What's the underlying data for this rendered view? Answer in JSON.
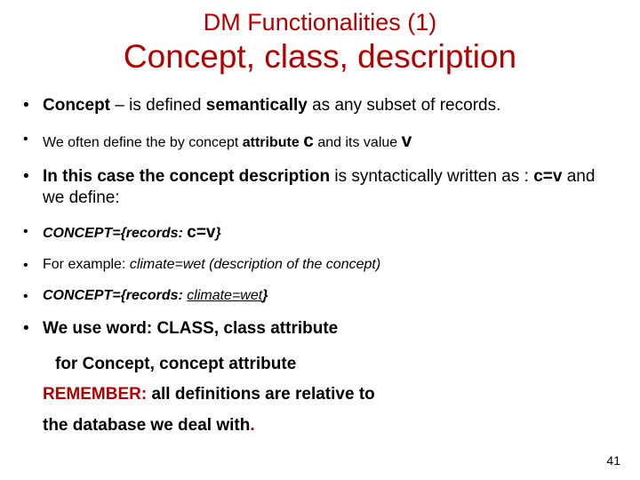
{
  "title": {
    "line1": "DM Functionalities (1)",
    "line2": "Concept, class, description"
  },
  "items": [
    {
      "pre_bold": "Concept",
      "mid_plain": " – is defined ",
      "mid_bold": "semantically ",
      "tail_plain": "as any subset of records.",
      "tail_period_red": true,
      "size": "big"
    },
    {
      "plain1": "We  often define the by concept ",
      "bold1": "attribute ",
      "bold_sym1": "c",
      "plain2": " and its value ",
      "bold_sym2": "v",
      "size": "small"
    },
    {
      "bold1": "In this case the concept description ",
      "plain1": "is syntactically written as :  ",
      "bold2": "c=v ",
      "plain2": "and we define:",
      "size": "big"
    },
    {
      "bi1": "CONCEPT={records:  ",
      "bold_sans": "c=v",
      "bi2": "}",
      "size": "small"
    },
    {
      "plain1": "For example:  ",
      "ital1": "climate=wet  (description of the concept)",
      "size": "small"
    },
    {
      "bi1": "CONCEPT={records: ",
      "ital_under": "climate=wet",
      "bi2": "}",
      "size": "small"
    },
    {
      "bold_all": "We use word: CLASS, class attribute",
      "size": "big"
    }
  ],
  "trail": {
    "l1_bold": "for Concept, concept attribute",
    "l2_bold_red": "REMEMBER:",
    "l2_bold_rest": " all definitions are relative to",
    "l3_bold": "the database we deal with",
    "l3_period_red": "."
  },
  "page": "41"
}
